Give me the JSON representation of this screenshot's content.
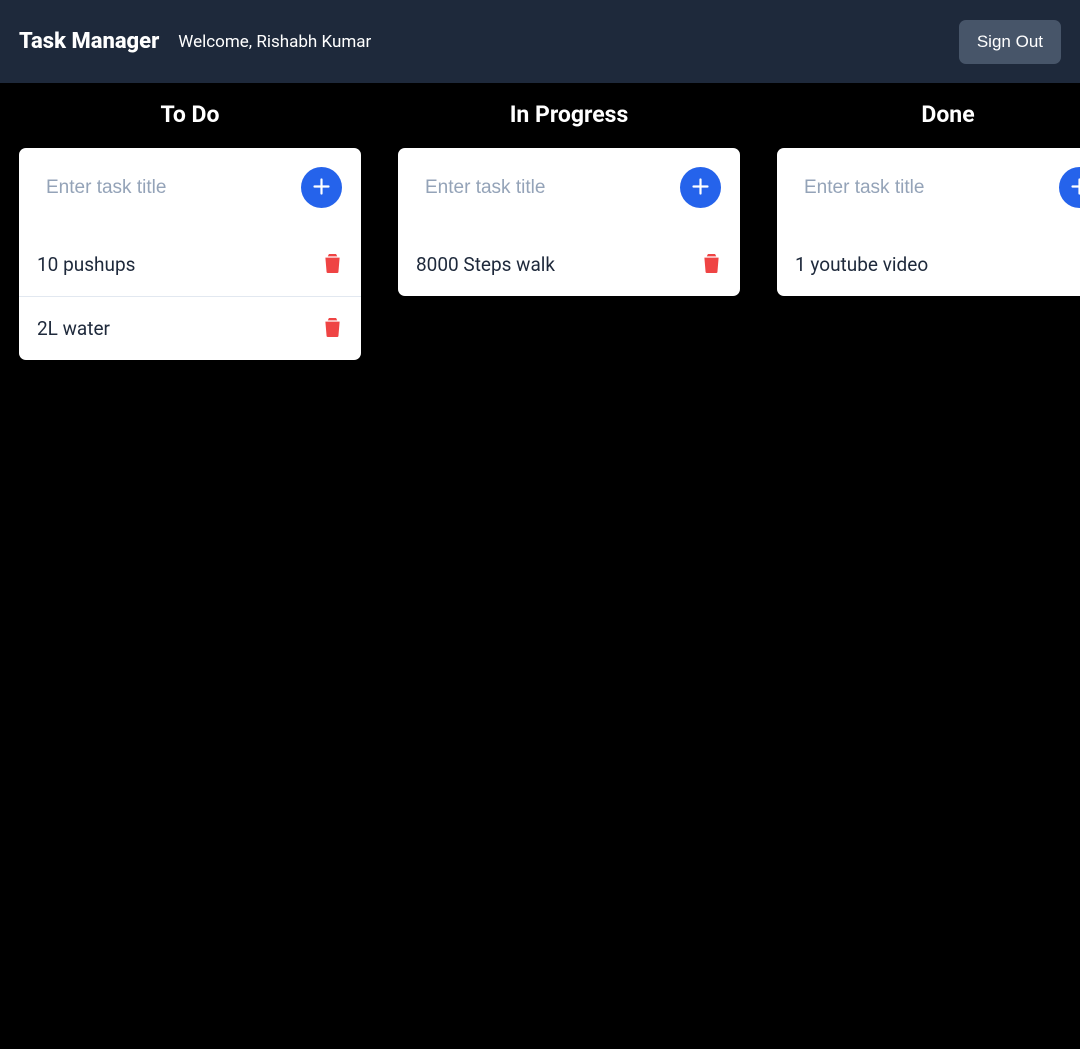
{
  "header": {
    "app_title": "Task Manager",
    "welcome": "Welcome, Rishabh Kumar",
    "signout_label": "Sign Out"
  },
  "input_placeholder": "Enter task title",
  "colors": {
    "header_bg": "#1e293b",
    "accent": "#2563eb",
    "danger": "#ef4444",
    "card_bg": "#ffffff",
    "body_bg": "#000000"
  },
  "columns": [
    {
      "title": "To Do",
      "tasks": [
        {
          "title": "10 pushups"
        },
        {
          "title": "2L water"
        }
      ]
    },
    {
      "title": "In Progress",
      "tasks": [
        {
          "title": "8000 Steps walk"
        }
      ]
    },
    {
      "title": "Done",
      "tasks": [
        {
          "title": "1 youtube video"
        }
      ]
    }
  ]
}
